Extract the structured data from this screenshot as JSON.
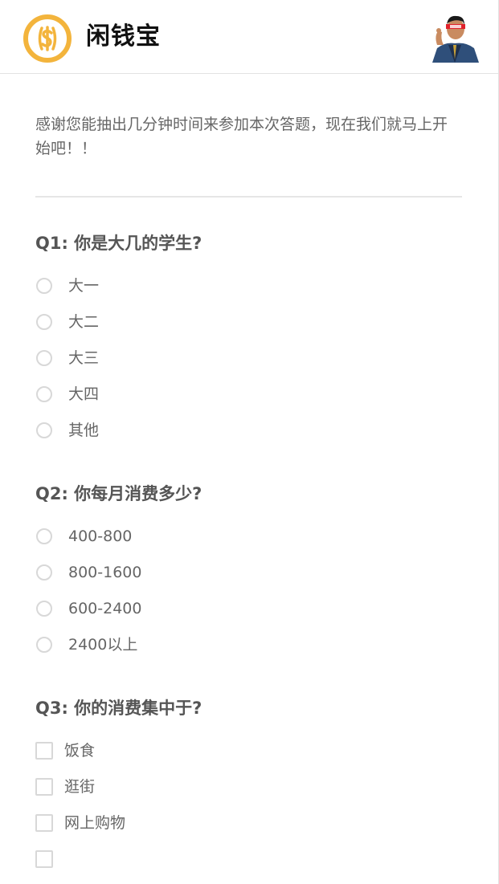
{
  "app": {
    "name": "闲钱宝",
    "logo_icon": "dollar-coin-icon",
    "accent_color": "#F3B43C"
  },
  "survey": {
    "intro": "感谢您能抽出几分钟时间来参加本次答题，现在我们就马上开始吧！！",
    "questions": [
      {
        "title": "Q1: 你是大几的学生?",
        "type": "radio",
        "options": [
          "大一",
          "大二",
          "大三",
          "大四",
          "其他"
        ]
      },
      {
        "title": "Q2: 你每月消费多少?",
        "type": "radio",
        "options": [
          "400-800",
          "800-1600",
          "600-2400",
          "2400以上"
        ]
      },
      {
        "title": "Q3: 你的消费集中于?",
        "type": "checkbox",
        "options": [
          "饭食",
          "逛街",
          "网上购物"
        ]
      }
    ]
  }
}
